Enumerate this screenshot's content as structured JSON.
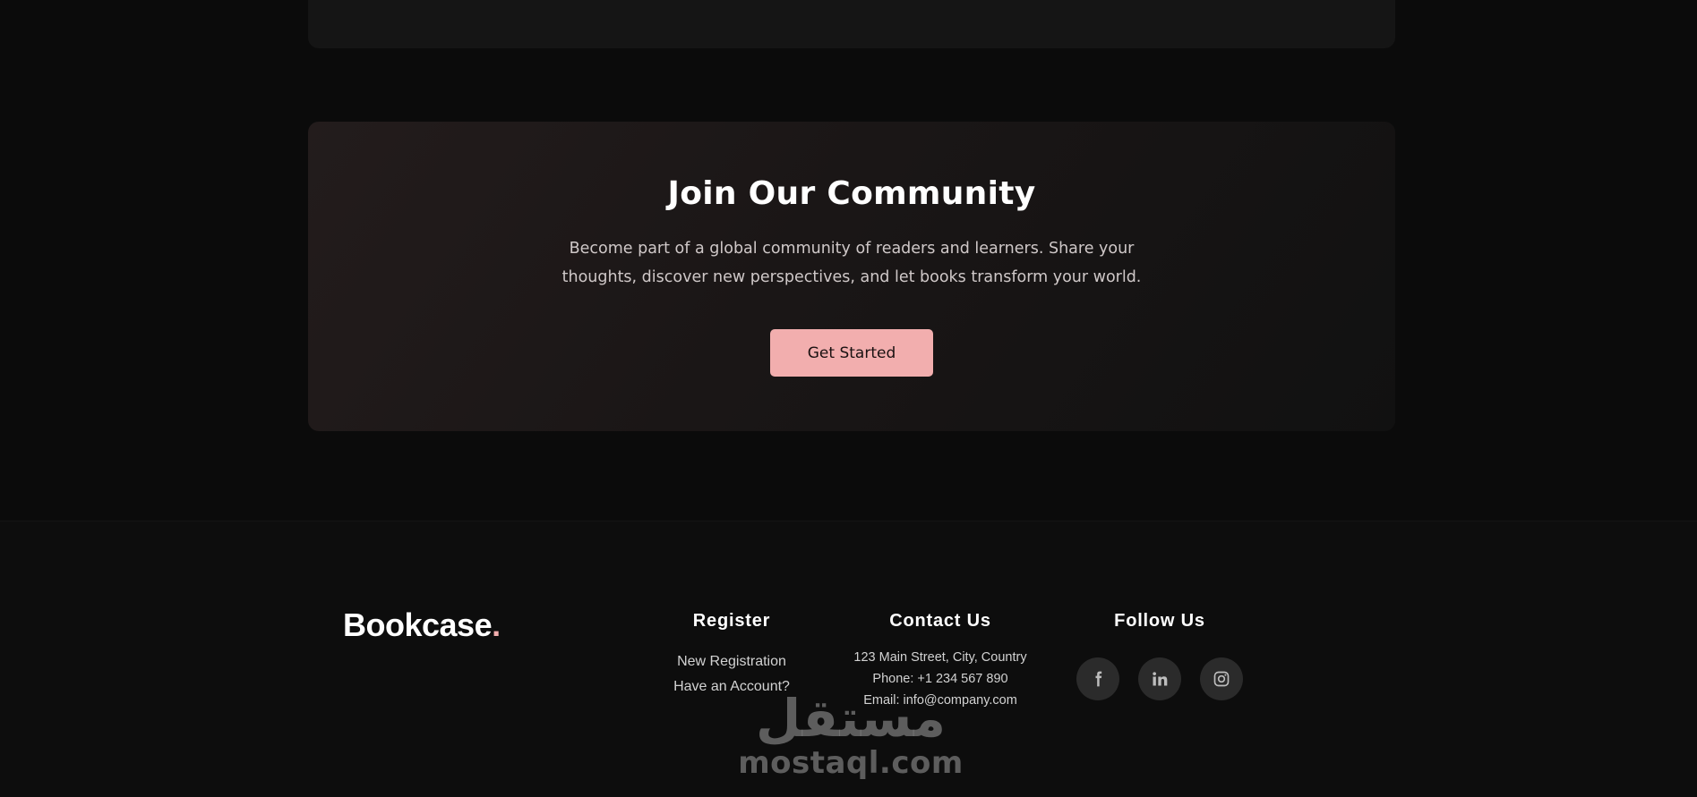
{
  "community": {
    "title": "Join Our Community",
    "description": "Become part of a global community of readers and learners. Share your thoughts, discover new perspectives, and let books transform your world.",
    "cta_label": "Get Started"
  },
  "footer": {
    "logo_text": "Bookcase",
    "logo_dot": ".",
    "register": {
      "title": "Register",
      "links": [
        "New Registration",
        "Have an Account?"
      ]
    },
    "contact": {
      "title": "Contact Us",
      "address": "123 Main Street, City, Country",
      "phone": "Phone: +1 234 567 890",
      "email": "Email: info@company.com"
    },
    "follow": {
      "title": "Follow Us",
      "icons": [
        "facebook-icon",
        "linkedin-icon",
        "instagram-icon"
      ]
    }
  },
  "watermark": {
    "arabic": "مستقل",
    "latin": "mostaql.com"
  },
  "colors": {
    "accent": "#f2aeae",
    "background": "#0b0b0b",
    "card": "#151515",
    "social_bg": "#2b2b2b"
  }
}
